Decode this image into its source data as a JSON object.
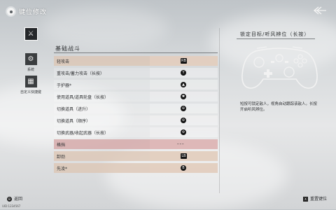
{
  "header": {
    "title": "键位修改",
    "back_icon": "back-arrow-icon"
  },
  "sidebar": {
    "items": [
      {
        "label": "",
        "icon": "crossed-swords-icon",
        "glyph": "⚔",
        "active": true
      },
      {
        "label": "系统",
        "icon": "gear-icon",
        "glyph": "⚙",
        "active": false
      },
      {
        "label": "自定义快捷键",
        "icon": "grid-icon",
        "glyph": "▦",
        "active": false
      }
    ]
  },
  "section": {
    "title": "基础战斗"
  },
  "bindings": [
    {
      "label": "轻攻击",
      "key": "RB",
      "style": "hl"
    },
    {
      "label": "重攻击/蓄力攻击（长按）",
      "key": "Y",
      "style": ""
    },
    {
      "label": "于护器*",
      "key": "▲",
      "style": ""
    },
    {
      "label": "使用道具/道具轮盘（长按）",
      "key": "✱",
      "style": ""
    },
    {
      "label": "切换道具（进升）",
      "key": "✣",
      "style": ""
    },
    {
      "label": "切换道具（顺序）",
      "key": "✣",
      "style": ""
    },
    {
      "label": "切换武器/收起武器（长按）",
      "key": "✣",
      "style": ""
    },
    {
      "label": "格挡",
      "key": "---",
      "style": "pink"
    },
    {
      "label": "卸劲",
      "key": "LB",
      "style": "hl"
    },
    {
      "label": "先凌*",
      "key": "B",
      "style": "hl"
    }
  ],
  "detail": {
    "title": "锁定目标/听风辨位（长按）",
    "description": "短按可锁定敌人，视角自动跟踪该敌人。长按开启听风辨位。",
    "controller_icon": "gamepad-icon"
  },
  "footer": {
    "back_key": "B",
    "back_label": "返回",
    "reset_key": "X",
    "reset_label": "重置键位",
    "small_text": "UID:1234567"
  }
}
